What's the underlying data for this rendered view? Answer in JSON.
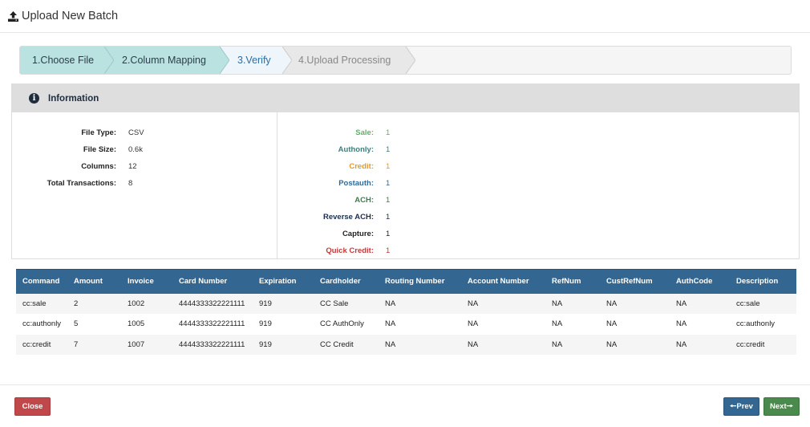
{
  "modal": {
    "title": "Upload New Batch",
    "title_icon": "upload-icon"
  },
  "wizard": {
    "steps": [
      {
        "label": "1.Choose File",
        "state": "complete"
      },
      {
        "label": "2.Column Mapping",
        "state": "complete"
      },
      {
        "label": "3.Verify",
        "state": "active"
      },
      {
        "label": "4.Upload Processing",
        "state": "pending"
      }
    ]
  },
  "info": {
    "title": "Information",
    "icon": "info-circle-icon",
    "file_stats": [
      {
        "label": "File Type:",
        "value": "CSV"
      },
      {
        "label": "File Size:",
        "value": "0.6k"
      },
      {
        "label": "Columns:",
        "value": "12"
      },
      {
        "label": "Total Transactions:",
        "value": "8"
      }
    ],
    "type_counts": [
      {
        "label": "Sale:",
        "value": "1",
        "color": "#6aaa6e"
      },
      {
        "label": "Authonly:",
        "value": "1",
        "color": "#3f7d7b"
      },
      {
        "label": "Credit:",
        "value": "1",
        "color": "#e09a2a"
      },
      {
        "label": "Postauth:",
        "value": "1",
        "color": "#2f6a96"
      },
      {
        "label": "ACH:",
        "value": "1",
        "color": "#467a4c"
      },
      {
        "label": "Reverse ACH:",
        "value": "1",
        "color": "#1c2f4d"
      },
      {
        "label": "Capture:",
        "value": "1",
        "color": "#222222"
      },
      {
        "label": "Quick Credit:",
        "value": "1",
        "color": "#c0393b"
      }
    ]
  },
  "table": {
    "columns": [
      "Command",
      "Amount",
      "Invoice",
      "Card Number",
      "Expiration",
      "Cardholder",
      "Routing Number",
      "Account Number",
      "RefNum",
      "CustRefNum",
      "AuthCode",
      "Description"
    ],
    "rows": [
      [
        "cc:sale",
        "2",
        "1002",
        "4444333322221111",
        "919",
        "CC Sale",
        "NA",
        "NA",
        "NA",
        "NA",
        "NA",
        "cc:sale"
      ],
      [
        "cc:authonly",
        "5",
        "1005",
        "4444333322221111",
        "919",
        "CC AuthOnly",
        "NA",
        "NA",
        "NA",
        "NA",
        "NA",
        "cc:authonly"
      ],
      [
        "cc:credit",
        "7",
        "1007",
        "4444333322221111",
        "919",
        "CC Credit",
        "NA",
        "NA",
        "NA",
        "NA",
        "NA",
        "cc:credit"
      ]
    ]
  },
  "footer": {
    "close_label": "Close",
    "prev_label": "Prev",
    "next_label": "Next",
    "prev_icon": "arrow-left-icon",
    "next_icon": "arrow-right-icon"
  }
}
